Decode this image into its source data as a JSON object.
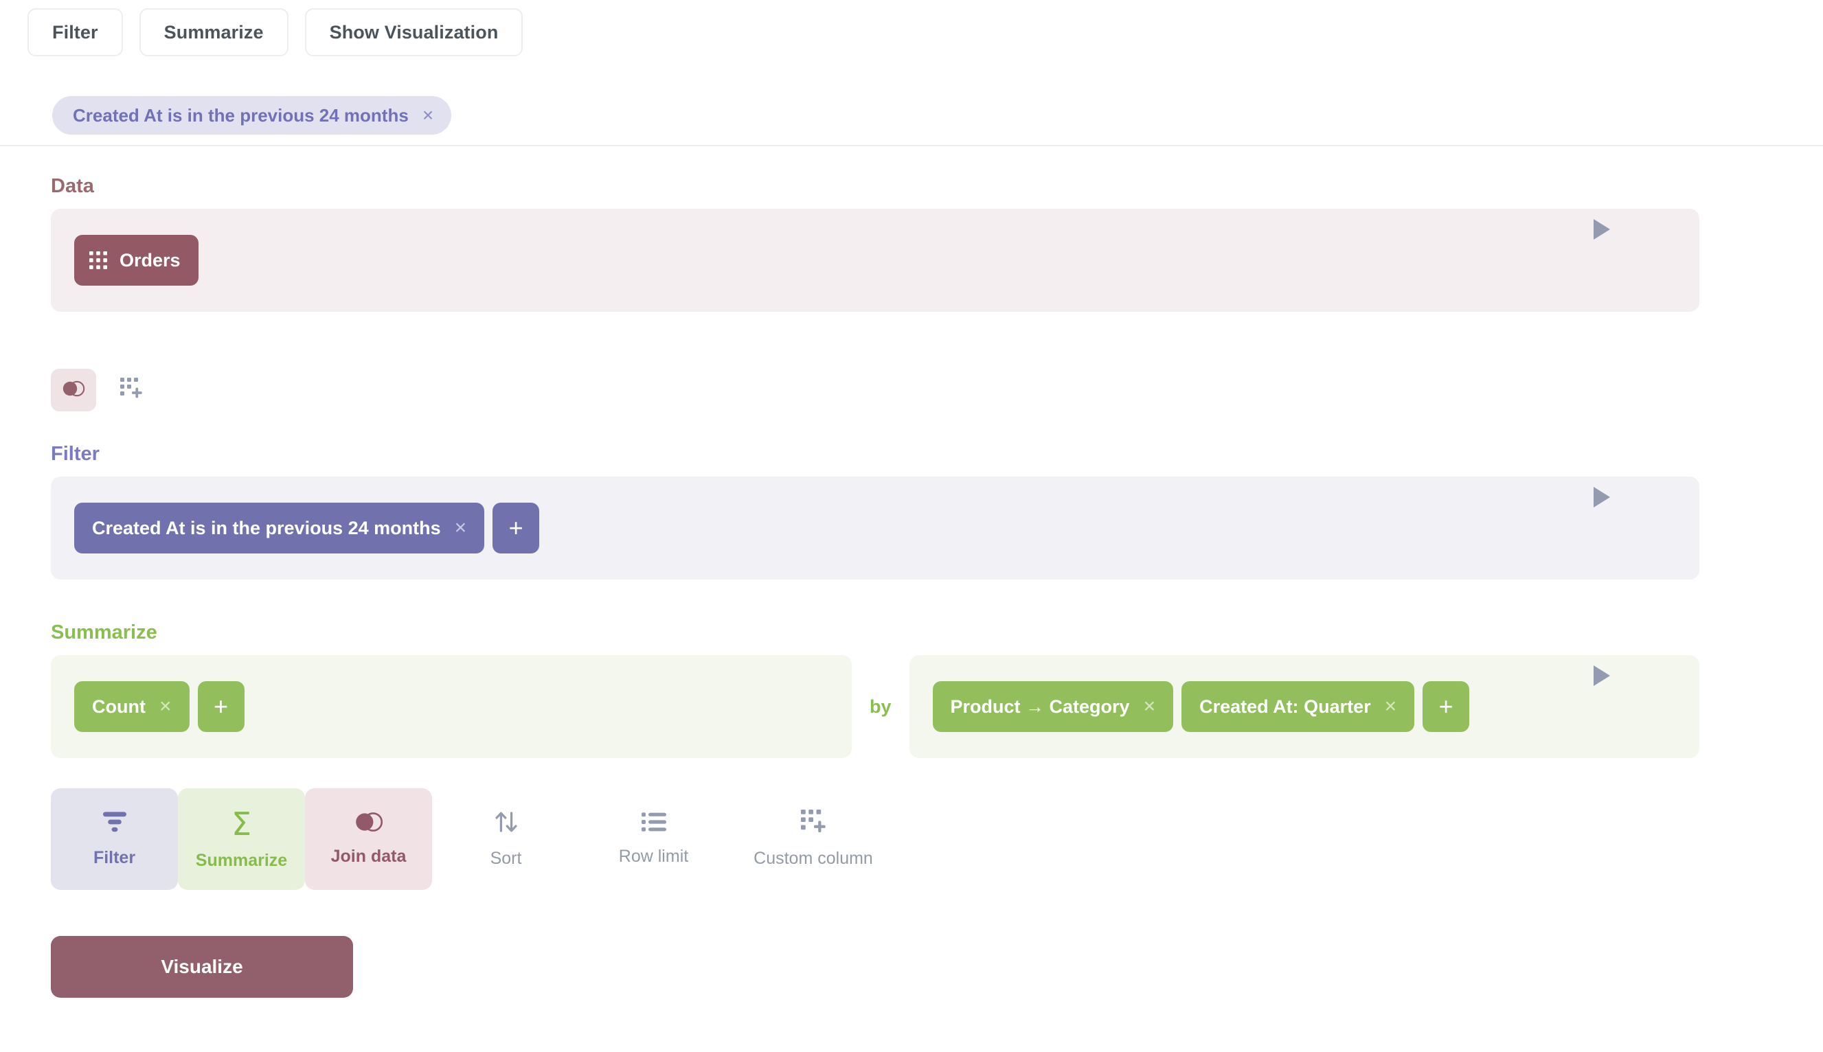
{
  "topbar": {
    "buttons": [
      {
        "label": "Filter",
        "name": "filter"
      },
      {
        "label": "Summarize",
        "name": "summarize"
      },
      {
        "label": "Show Visualization",
        "name": "show-visualization"
      }
    ]
  },
  "filter_chip": {
    "label": "Created At is in the previous 24 months",
    "remove": "×"
  },
  "sections": {
    "data": {
      "label": "Data",
      "table": "Orders",
      "table_icon": "grid-icon",
      "tools": [
        {
          "name": "join-data-icon",
          "title": "Join data"
        },
        {
          "name": "custom-column-icon",
          "title": "Custom column"
        }
      ]
    },
    "filter": {
      "label": "Filter",
      "clauses": [
        {
          "label": "Created At is in the previous 24 months",
          "remove": "×"
        }
      ],
      "add": "+"
    },
    "summarize": {
      "label": "Summarize",
      "aggregations": [
        {
          "label": "Count",
          "remove": "×"
        }
      ],
      "add_aggregation": "+",
      "by": "by",
      "breakouts": [
        {
          "label": "Product → Category",
          "remove": "×"
        },
        {
          "label": "Created At: Quarter",
          "remove": "×"
        }
      ],
      "add_breakout": "+"
    }
  },
  "actions": [
    {
      "label": "Filter",
      "icon": "funnel-icon",
      "name": "filter"
    },
    {
      "label": "Summarize",
      "icon": "sigma-icon",
      "name": "summarize",
      "glyph": "Σ"
    },
    {
      "label": "Join data",
      "icon": "join-icon",
      "name": "join-data"
    },
    {
      "label": "Sort",
      "icon": "sort-icon",
      "name": "sort"
    },
    {
      "label": "Row limit",
      "icon": "list-icon",
      "name": "row-limit"
    },
    {
      "label": "Custom column",
      "icon": "custom-column-icon",
      "name": "custom-column"
    }
  ],
  "visualize": {
    "label": "Visualize"
  },
  "colors": {
    "brand_maroon": "#935a65",
    "filter_purple": "#7172ad",
    "summarize_green": "#92bf5c",
    "chip_lavender": "#e2e1ef",
    "gray_text": "#939ba5",
    "expand_arrow": "#949bb0"
  }
}
